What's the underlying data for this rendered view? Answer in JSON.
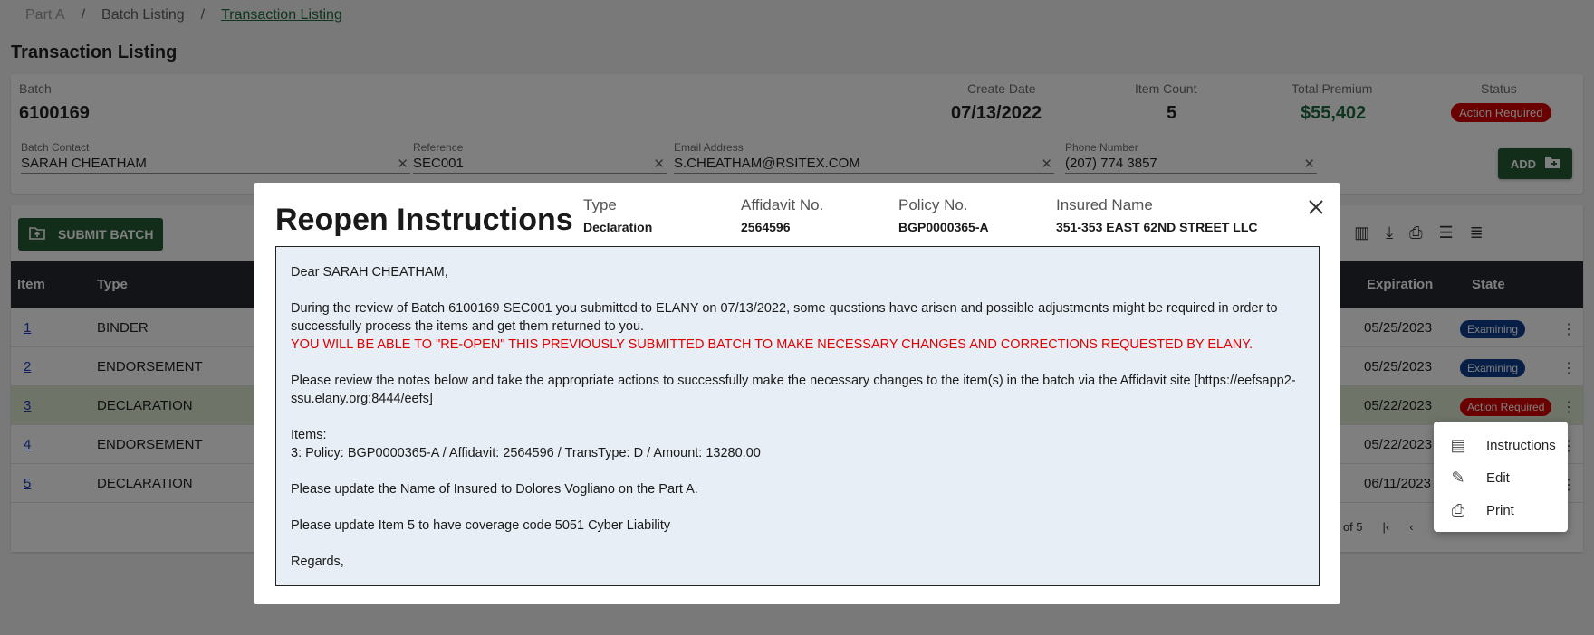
{
  "breadcrumb": {
    "part_a": "Part A",
    "sep1": "/",
    "batch_listing": "Batch Listing",
    "sep2": "/",
    "transaction_listing": "Transaction Listing"
  },
  "page_title": "Transaction Listing",
  "batch": {
    "batch_label": "Batch",
    "batch_value": "6100169",
    "create_date_label": "Create Date",
    "create_date_value": "07/13/2022",
    "item_count_label": "Item Count",
    "item_count_value": "5",
    "total_premium_label": "Total Premium",
    "total_premium_value": "$55,402",
    "status_label": "Status",
    "status_value": "Action Required",
    "contact_label": "Batch Contact",
    "contact_value": "SARAH CHEATHAM",
    "reference_label": "Reference",
    "reference_value": "SEC001",
    "email_label": "Email Address",
    "email_value": "S.CHEATHAM@RSITEX.COM",
    "phone_label": "Phone Number",
    "phone_value": "(207) 774 3857",
    "add_label": "ADD"
  },
  "toolbar": {
    "submit_label": "SUBMIT BATCH"
  },
  "table": {
    "headers": {
      "item": "Item",
      "type": "Type",
      "expiration": "Expiration",
      "state": "State"
    },
    "rows": [
      {
        "item": "1",
        "type": "BINDER",
        "expiration": "05/25/2023",
        "state": "Examining"
      },
      {
        "item": "2",
        "type": "ENDORSEMENT",
        "expiration": "05/25/2023",
        "state": "Examining"
      },
      {
        "item": "3",
        "type": "DECLARATION",
        "expiration": "05/22/2023",
        "state": "Action Required"
      },
      {
        "item": "4",
        "type": "ENDORSEMENT",
        "expiration": "05/22/2023",
        "state": ""
      },
      {
        "item": "5",
        "type": "DECLARATION",
        "expiration": "06/11/2023",
        "state": ""
      }
    ],
    "pager_text": "5 of 5"
  },
  "context_menu": {
    "instructions": "Instructions",
    "edit": "Edit",
    "print": "Print"
  },
  "modal": {
    "title": "Reopen Instructions",
    "type_label": "Type",
    "type_value": "Declaration",
    "affidavit_label": "Affidavit No.",
    "affidavit_value": "2564596",
    "policy_label": "Policy No.",
    "policy_value": "BGP0000365-A",
    "insured_label": "Insured Name",
    "insured_value": "351-353 EAST 62ND STREET LLC",
    "letter": {
      "greeting": "Dear SARAH CHEATHAM,",
      "para1": "During the review of Batch 6100169 SEC001 you submitted to ELANY on 07/13/2022, some questions have arisen and possible adjustments might be required in order to successfully process the items and get them returned to you.",
      "warning": "YOU WILL BE ABLE TO \"RE-OPEN\" THIS PREVIOUSLY SUBMITTED BATCH TO MAKE NECESSARY CHANGES AND CORRECTIONS REQUESTED BY ELANY.",
      "para2": "Please review the notes below and take the appropriate actions to successfully make the necessary changes to the item(s) in the batch via the Affidavit site [https://eefsapp2-ssu.elany.org:8444/eefs]",
      "items_heading": "Items:",
      "item_line": "3: Policy: BGP0000365-A / Affidavit: 2564596 / TransType: D / Amount: 13280.00",
      "note1": "Please update the Name of Insured to Dolores Vogliano on the Part A.",
      "note2": "Please update Item 5 to have coverage code 5051 Cyber Liability",
      "closing": "Regards,"
    }
  },
  "colors": {
    "brand_green": "#245c37",
    "alert_red": "#d40000",
    "chip_blue": "#0f3d8c"
  }
}
